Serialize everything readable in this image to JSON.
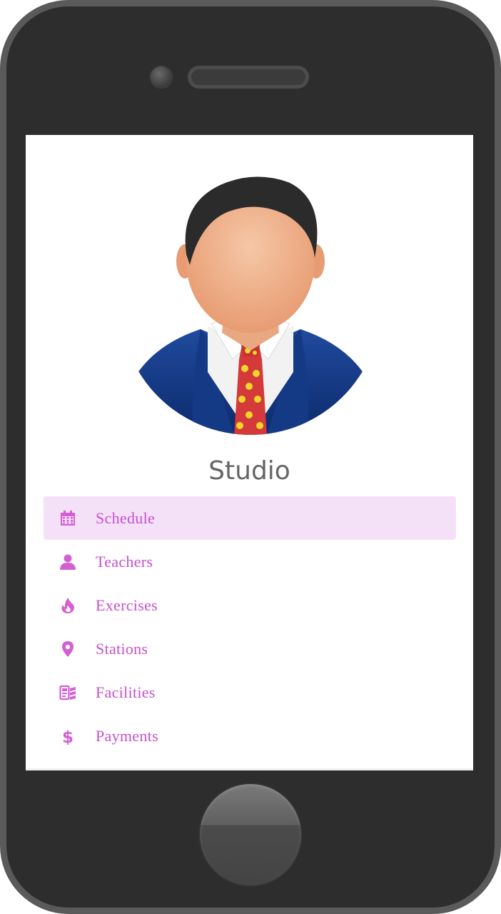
{
  "app": {
    "title": "Studio"
  },
  "menu": {
    "items": [
      {
        "label": "Schedule",
        "icon": "calendar-icon",
        "active": true
      },
      {
        "label": "Teachers",
        "icon": "user-icon",
        "active": false
      },
      {
        "label": "Exercises",
        "icon": "fire-icon",
        "active": false
      },
      {
        "label": "Stations",
        "icon": "map-pin-icon",
        "active": false
      },
      {
        "label": "Facilities",
        "icon": "facilities-icon",
        "active": false
      },
      {
        "label": "Payments",
        "icon": "dollar-icon",
        "active": false
      }
    ]
  },
  "colors": {
    "accent": "#c64fd0",
    "active_background": "#f5e1f7",
    "phone_body": "#2d2d2d",
    "title_text": "#666666"
  }
}
